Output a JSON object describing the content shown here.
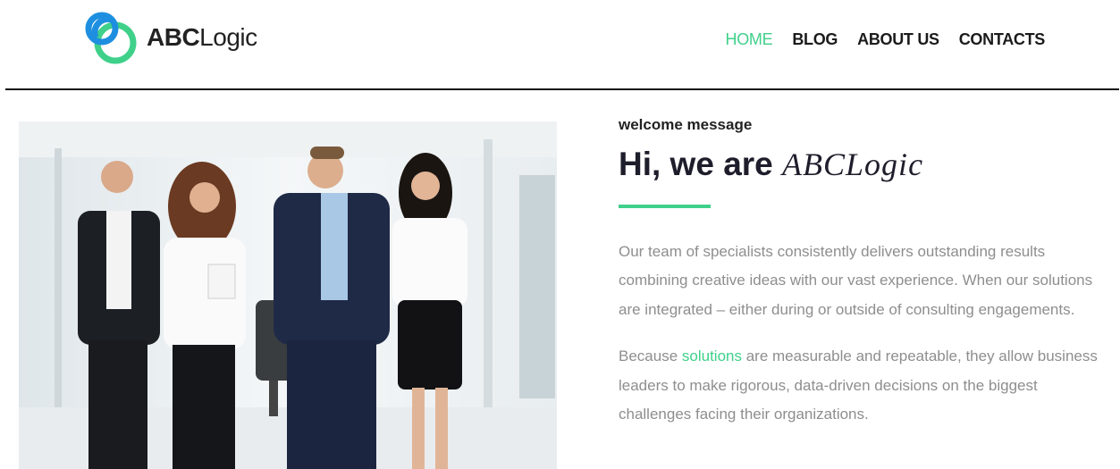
{
  "header": {
    "logo": {
      "bold": "ABC",
      "light": "Logic"
    },
    "nav": [
      {
        "label": "HOME",
        "active": true
      },
      {
        "label": "BLOG",
        "active": false
      },
      {
        "label": "ABOUT US",
        "active": false
      },
      {
        "label": "CONTACTS",
        "active": false
      }
    ]
  },
  "hero": {
    "photo": "team-of-four-business-people-walking-in-office"
  },
  "about": {
    "eyebrow": "welcome message",
    "headline_prefix": "Hi, we are",
    "headline_brand": "ABCLogic",
    "paragraph1": "Our team of specialists consistently delivers outstanding results combining creative ideas with our vast experience. When our solutions are integrated – either during or outside of consulting engagements.",
    "paragraph2_before": "Because ",
    "paragraph2_link": "solutions",
    "paragraph2_after": " are measurable and repeatable, they allow business leaders to make rigorous, data-driven decisions on the biggest challenges facing their organizations."
  },
  "colors": {
    "accent": "#3fd08a",
    "logo_blue": "#1e8fe0",
    "text_dark": "#1e1d2b",
    "text_muted": "#8e8e8e"
  }
}
